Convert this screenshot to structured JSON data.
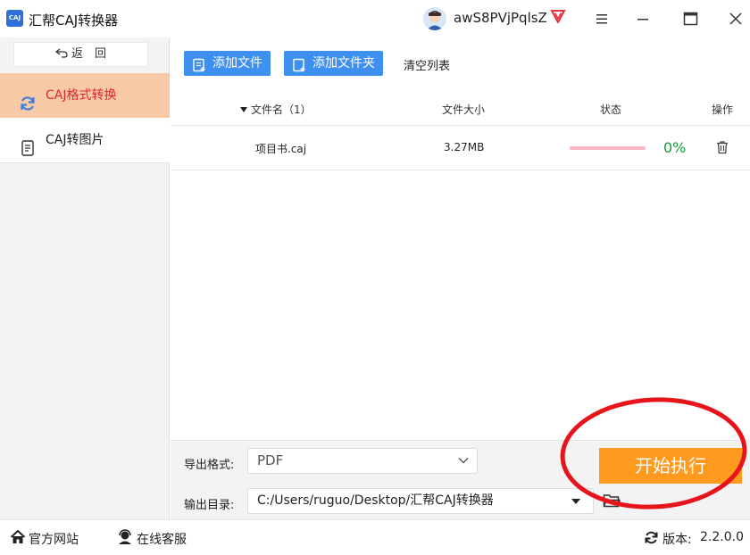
{
  "app": {
    "title": "汇帮CAJ转换器",
    "logo_text": "CAJ"
  },
  "user": {
    "name": "awS8PVjPqlsZ"
  },
  "sidebar": {
    "back_label": "返　回",
    "items": [
      {
        "label": "CAJ格式转换",
        "active": true
      },
      {
        "label": "CAJ转图片",
        "active": false
      }
    ]
  },
  "toolbar": {
    "add_file_label": "添加文件",
    "add_folder_label": "添加文件夹",
    "clear_label": "清空列表"
  },
  "table": {
    "headers": {
      "name": "文件名（1）",
      "size": "文件大小",
      "status": "状态",
      "op": "操作"
    },
    "rows": [
      {
        "name": "项目书.caj",
        "size": "3.27MB",
        "progress": "0%",
        "progress_value": 0
      }
    ]
  },
  "output": {
    "format_label": "导出格式:",
    "format_value": "PDF",
    "dir_label": "输出目录:",
    "dir_value": "C:/Users/ruguo/Desktop/汇帮CAJ转换器",
    "start_label": "开始执行"
  },
  "statusbar": {
    "site_label": "官方网站",
    "support_label": "在线客服",
    "version_label": "版本:",
    "version_value": "2.2.0.0"
  },
  "colors": {
    "accent_blue": "#3d8ff0",
    "start_orange": "#ff9a1f",
    "active_bg": "#f7c9a6",
    "active_text": "#e02a2a",
    "progress_green": "#1a9a3a",
    "annotation_red": "#e8141c"
  }
}
